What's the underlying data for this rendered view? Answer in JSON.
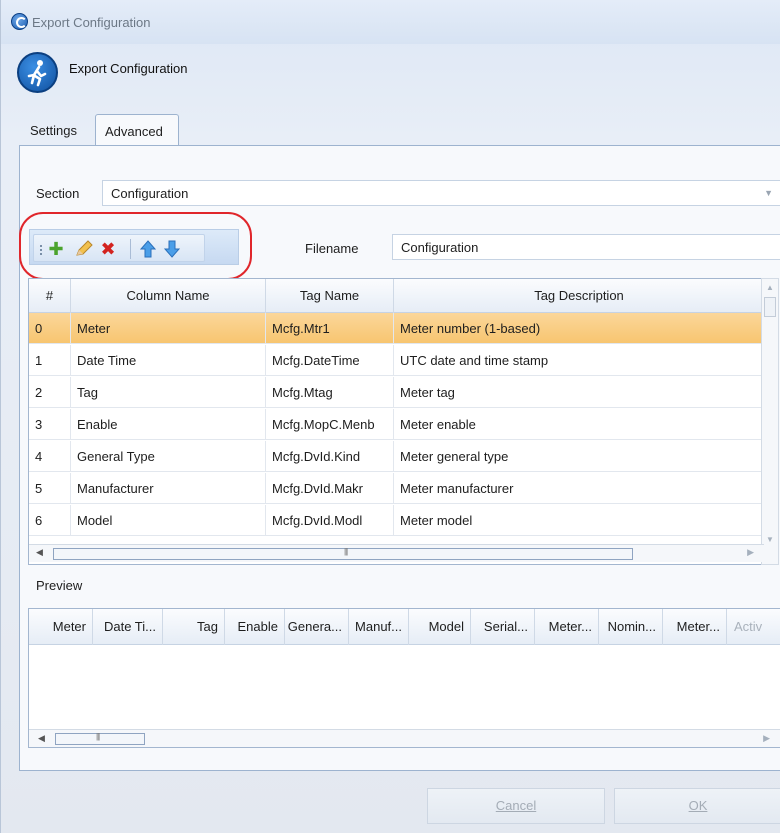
{
  "window": {
    "title": "Export Configuration"
  },
  "header": {
    "title": "Export Configuration"
  },
  "tabs": [
    {
      "label": "Settings"
    },
    {
      "label": "Advanced"
    }
  ],
  "section": {
    "label": "Section",
    "value": "Configuration"
  },
  "filename": {
    "label": "Filename",
    "value": "Configuration"
  },
  "colors": {
    "selected_row": "#f8c875",
    "accent": "#1b5cb0",
    "annotation": "#e0262b"
  },
  "toolbar": {
    "icons": [
      "add-icon",
      "edit-icon",
      "delete-icon",
      "move-up-icon",
      "move-down-icon"
    ]
  },
  "grid": {
    "headers": [
      "#",
      "Column Name",
      "Tag Name",
      "Tag Description"
    ],
    "rows": [
      {
        "num": "0",
        "column": "Meter",
        "tag": "Mcfg.Mtr1",
        "desc": "Meter number (1-based)"
      },
      {
        "num": "1",
        "column": "Date Time",
        "tag": "Mcfg.DateTime",
        "desc": "UTC date and time stamp"
      },
      {
        "num": "2",
        "column": "Tag",
        "tag": "Mcfg.Mtag",
        "desc": "Meter tag"
      },
      {
        "num": "3",
        "column": "Enable",
        "tag": "Mcfg.MopC.Menb",
        "desc": "Meter enable"
      },
      {
        "num": "4",
        "column": "General Type",
        "tag": "Mcfg.DvId.Kind",
        "desc": "Meter general type"
      },
      {
        "num": "5",
        "column": "Manufacturer",
        "tag": "Mcfg.DvId.Makr",
        "desc": "Meter manufacturer"
      },
      {
        "num": "6",
        "column": "Model",
        "tag": "Mcfg.DvId.Modl",
        "desc": "Meter model"
      }
    ]
  },
  "preview": {
    "label": "Preview",
    "headers": [
      "Meter",
      "Date Ti...",
      "Tag",
      "Enable",
      "Genera...",
      "Manuf...",
      "Model",
      "Serial...",
      "Meter...",
      "Nomin...",
      "Meter...",
      "Activ"
    ]
  },
  "footer": {
    "cancel_label": "Cancel",
    "ok_label": "OK"
  }
}
